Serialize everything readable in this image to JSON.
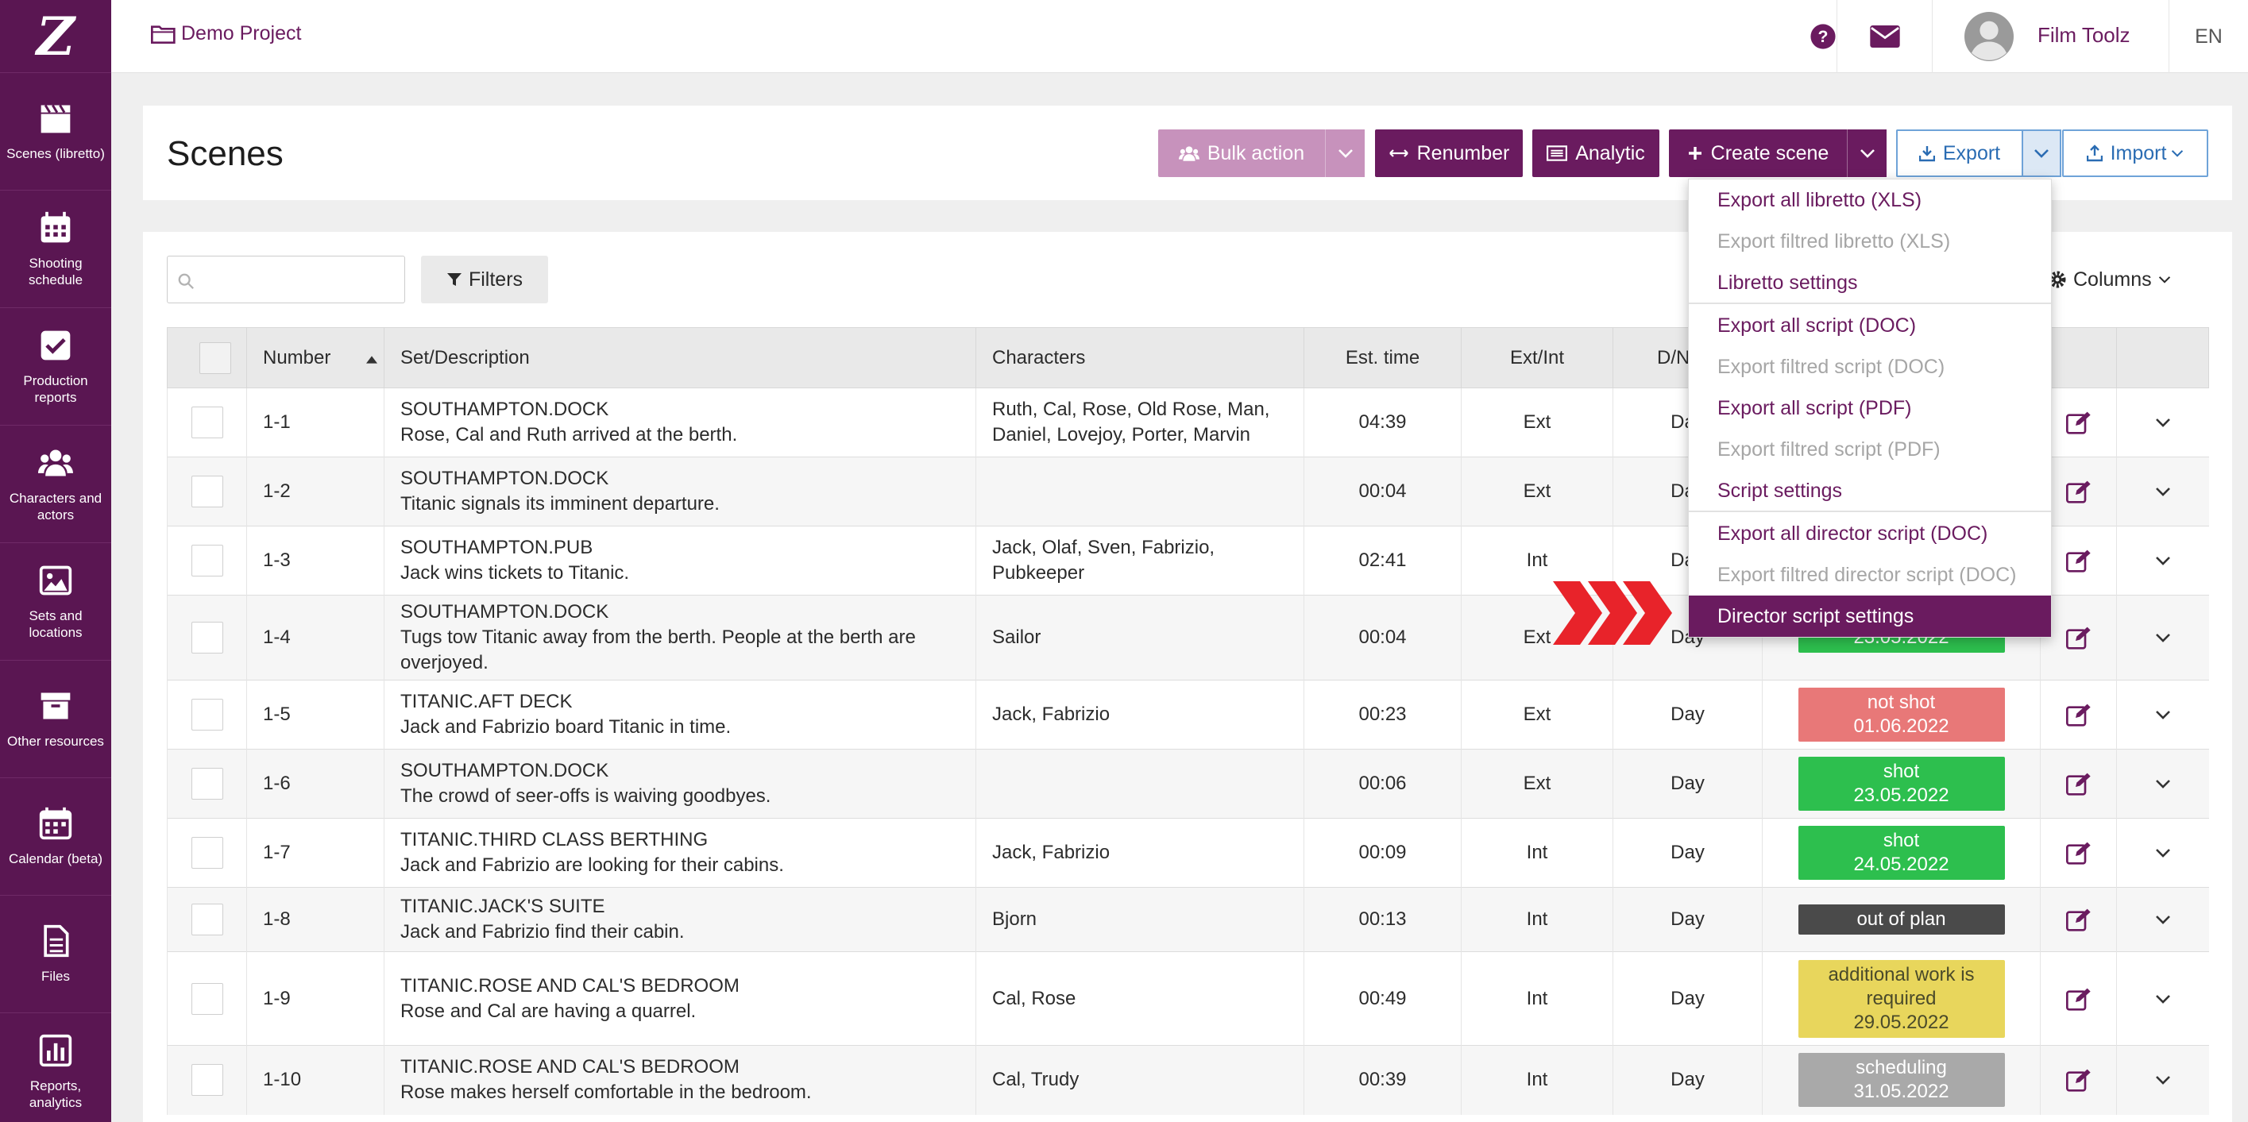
{
  "app": {
    "logo": "Z"
  },
  "sidebar": {
    "items": [
      {
        "label": "Scenes (libretto)",
        "icon": "clapperboard-icon"
      },
      {
        "label": "Shooting schedule",
        "icon": "calendar-grid-icon"
      },
      {
        "label": "Production reports",
        "icon": "checkbox-icon"
      },
      {
        "label": "Characters and actors",
        "icon": "users-icon"
      },
      {
        "label": "Sets and locations",
        "icon": "image-icon"
      },
      {
        "label": "Other resources",
        "icon": "archive-icon"
      },
      {
        "label": "Calendar (beta)",
        "icon": "calendar-icon"
      },
      {
        "label": "Files",
        "icon": "file-icon"
      },
      {
        "label": "Reports, analytics",
        "icon": "bar-chart-icon"
      }
    ]
  },
  "topbar": {
    "project": "Demo Project",
    "user_name": "Film Toolz",
    "language": "EN",
    "icons": [
      "folder-icon",
      "help-icon",
      "mail-icon",
      "avatar"
    ]
  },
  "header": {
    "title": "Scenes",
    "buttons": {
      "bulk_action": "Bulk action",
      "renumber": "Renumber",
      "analytic": "Analytic",
      "create_scene": "Create scene",
      "export": "Export",
      "import": "Import"
    }
  },
  "toolbar": {
    "search_placeholder": "",
    "filters": "Filters",
    "columns": "Columns"
  },
  "export_menu": {
    "items": [
      {
        "label": "Export all libretto (XLS)",
        "state": "active"
      },
      {
        "label": "Export filtred libretto (XLS)",
        "state": "disabled"
      },
      {
        "label": "Libretto settings",
        "state": "active"
      },
      {
        "label": "Export all script (DOC)",
        "state": "active"
      },
      {
        "label": "Export filtred script (DOC)",
        "state": "disabled"
      },
      {
        "label": "Export all script (PDF)",
        "state": "active"
      },
      {
        "label": "Export filtred script (PDF)",
        "state": "disabled"
      },
      {
        "label": "Script settings",
        "state": "active"
      },
      {
        "label": "Export all director script (DOC)",
        "state": "active"
      },
      {
        "label": "Export filtred director script (DOC)",
        "state": "disabled"
      },
      {
        "label": "Director script settings",
        "state": "selected"
      }
    ]
  },
  "table": {
    "columns": [
      "",
      "Number",
      "Set/Description",
      "Characters",
      "Est. time",
      "Ext/Int",
      "D/N",
      "",
      "",
      ""
    ],
    "rows": [
      {
        "number": "1-1",
        "set": "SOUTHAMPTON.DOCK",
        "desc": "Rose, Cal and Ruth arrived at the berth.",
        "characters": "Ruth, Cal, Rose, Old Rose, Man, Daniel, Lovejoy, Porter, Marvin",
        "time": "04:39",
        "extint": "Ext",
        "dn": "Day",
        "status": "",
        "date": "",
        "status_color": ""
      },
      {
        "number": "1-2",
        "set": "SOUTHAMPTON.DOCK",
        "desc": "Titanic signals its imminent departure.",
        "characters": "",
        "time": "00:04",
        "extint": "Ext",
        "dn": "Day",
        "status": "",
        "date": "",
        "status_color": ""
      },
      {
        "number": "1-3",
        "set": "SOUTHAMPTON.PUB",
        "desc": "Jack wins tickets to Titanic.",
        "characters": "Jack, Olaf, Sven, Fabrizio, Pubkeeper",
        "time": "02:41",
        "extint": "Int",
        "dn": "Day",
        "status": "",
        "date": "",
        "status_color": ""
      },
      {
        "number": "1-4",
        "set": "SOUTHAMPTON.DOCK",
        "desc": "Tugs tow Titanic away from the berth. People at the berth are overjoyed.",
        "characters": "Sailor",
        "time": "00:04",
        "extint": "Ext",
        "dn": "Day",
        "status": "",
        "date": "23.05.2022",
        "status_color": "#2dbf4e"
      },
      {
        "number": "1-5",
        "set": "TITANIC.AFT DECK",
        "desc": "Jack and Fabrizio board Titanic in time.",
        "characters": "Jack, Fabrizio",
        "time": "00:23",
        "extint": "Ext",
        "dn": "Day",
        "status": "not shot",
        "date": "01.06.2022",
        "status_color": "#e87878"
      },
      {
        "number": "1-6",
        "set": "SOUTHAMPTON.DOCK",
        "desc": "The crowd of seer-offs is waiving goodbyes.",
        "characters": "",
        "time": "00:06",
        "extint": "Ext",
        "dn": "Day",
        "status": "shot",
        "date": "23.05.2022",
        "status_color": "#2dbf4e"
      },
      {
        "number": "1-7",
        "set": "TITANIC.THIRD CLASS BERTHING",
        "desc": "Jack and Fabrizio are looking for their cabins.",
        "characters": "Jack, Fabrizio",
        "time": "00:09",
        "extint": "Int",
        "dn": "Day",
        "status": "shot",
        "date": "24.05.2022",
        "status_color": "#2dbf4e"
      },
      {
        "number": "1-8",
        "set": "TITANIC.JACK'S SUITE",
        "desc": "Jack and Fabrizio find their cabin.",
        "characters": "Bjorn",
        "time": "00:13",
        "extint": "Int",
        "dn": "Day",
        "status": "out of plan",
        "date": "",
        "status_color": "#4a4a4a"
      },
      {
        "number": "1-9",
        "set": "TITANIC.ROSE AND CAL'S BEDROOM",
        "desc": "Rose and Cal are having a quarrel.",
        "characters": "Cal, Rose",
        "time": "00:49",
        "extint": "Int",
        "dn": "Day",
        "status": "additional work is required",
        "date": "29.05.2022",
        "status_color": "#e8d65c"
      },
      {
        "number": "1-10",
        "set": "TITANIC.ROSE AND CAL'S BEDROOM",
        "desc": "Rose makes herself comfortable in the bedroom.",
        "characters": "Cal, Trudy",
        "time": "00:39",
        "extint": "Int",
        "dn": "Day",
        "status": "scheduling",
        "date": "31.05.2022",
        "status_color": "#a9a9a9"
      }
    ]
  },
  "colors": {
    "brand": "#6a1b5f",
    "sidebar": "#5a1652",
    "bulk": "#c792bc",
    "export_blue": "#2a6cb3",
    "arrow": "#e8232a"
  }
}
